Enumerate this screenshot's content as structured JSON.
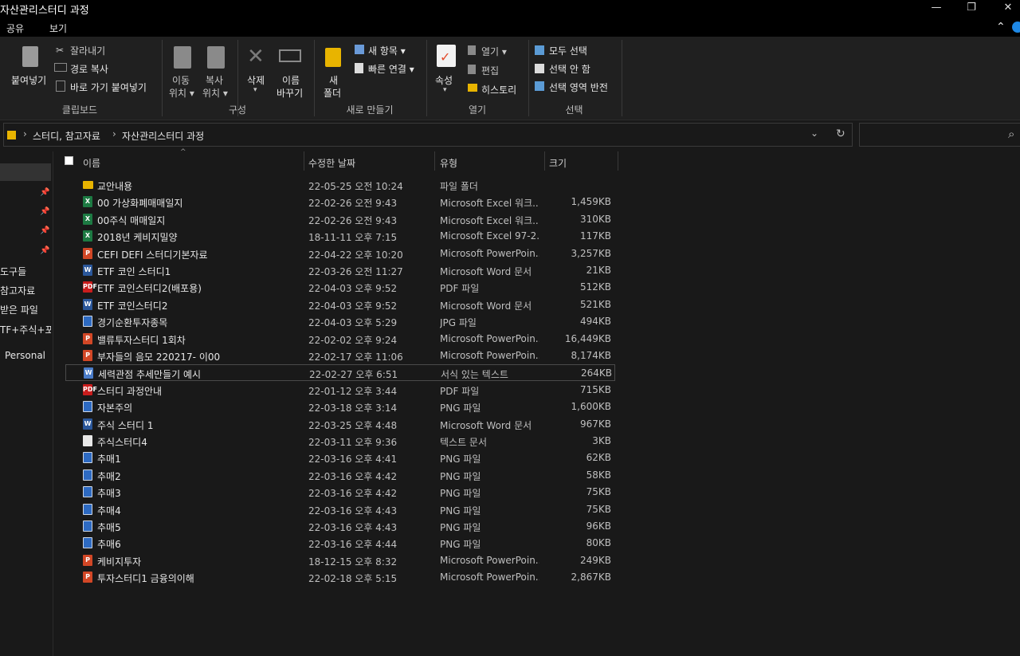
{
  "window": {
    "title": "자산관리스터디 과정",
    "controls": {
      "minimize": "—",
      "maximize": "❐",
      "close": "✕"
    }
  },
  "menu": {
    "share": "공유",
    "view": "보기",
    "collapse": "⌃"
  },
  "ribbon": {
    "clipboard": {
      "paste": "붙여넣기",
      "cut": "잘라내기",
      "copy_path": "경로 복사",
      "paste_shortcut": "바로 가기 붙여넣기",
      "label": "클립보드"
    },
    "organize": {
      "move_to_1": "이동",
      "move_to_2": "위치 ▾",
      "copy_to_1": "복사",
      "copy_to_2": "위치 ▾",
      "delete": "삭제",
      "delete_arrow": "▾",
      "rename_1": "이름",
      "rename_2": "바꾸기",
      "label": "구성"
    },
    "new": {
      "new_folder_1": "새",
      "new_folder_2": "폴더",
      "new_item": "새 항목 ▾",
      "easy_access": "빠른 연결 ▾",
      "label": "새로 만들기"
    },
    "open": {
      "properties": "속성",
      "properties_arrow": "▾",
      "open": "열기 ▾",
      "edit": "편집",
      "history": "히스토리",
      "label": "열기"
    },
    "select": {
      "select_all": "모두 선택",
      "select_none": "선택 안 함",
      "invert": "선택 영역 반전",
      "label": "선택"
    }
  },
  "address": {
    "crumbs": [
      "스터디, 참고자료",
      "자산관리스터디 과정"
    ],
    "sep": "›",
    "dropdown": "⌄",
    "refresh": "↻",
    "search_icon": "⌕"
  },
  "nav": {
    "items": [
      "도구들",
      "참고자료",
      "받은 파일",
      "TF+주식+포",
      "Personal"
    ]
  },
  "columns": {
    "name": "이름",
    "date": "수정한 날짜",
    "type": "유형",
    "size": "크기"
  },
  "files": [
    {
      "name": "교안내용",
      "date": "22-05-25 오전 10:24",
      "type": "파일 폴더",
      "size": "",
      "icon": "folder"
    },
    {
      "name": "00  가상화폐매매일지",
      "date": "22-02-26 오전 9:43",
      "type": "Microsoft Excel 워크...",
      "size": "1,459KB",
      "icon": "excel"
    },
    {
      "name": "00주식 매매일지",
      "date": "22-02-26 오전 9:43",
      "type": "Microsoft Excel 워크...",
      "size": "310KB",
      "icon": "excel"
    },
    {
      "name": "2018년  케비지밀양",
      "date": "18-11-11 오후 7:15",
      "type": "Microsoft Excel 97-2...",
      "size": "117KB",
      "icon": "excel"
    },
    {
      "name": "CEFI DEFI 스터디기본자료",
      "date": "22-04-22 오후 10:20",
      "type": "Microsoft PowerPoin...",
      "size": "3,257KB",
      "icon": "ppt"
    },
    {
      "name": "ETF 코인 스터디1",
      "date": "22-03-26 오전 11:27",
      "type": "Microsoft Word 문서",
      "size": "21KB",
      "icon": "word"
    },
    {
      "name": "ETF 코인스터디2(배포용)",
      "date": "22-04-03 오후 9:52",
      "type": "PDF 파일",
      "size": "512KB",
      "icon": "pdf"
    },
    {
      "name": "ETF 코인스터디2",
      "date": "22-04-03 오후 9:52",
      "type": "Microsoft Word 문서",
      "size": "521KB",
      "icon": "word"
    },
    {
      "name": "경기순환투자종목",
      "date": "22-04-03 오후 5:29",
      "type": "JPG 파일",
      "size": "494KB",
      "icon": "img"
    },
    {
      "name": "밸류투자스터디 1회차",
      "date": "22-02-02 오후 9:24",
      "type": "Microsoft PowerPoin...",
      "size": "16,449KB",
      "icon": "ppt"
    },
    {
      "name": "부자들의 음모 220217- 이00",
      "date": "22-02-17 오후 11:06",
      "type": "Microsoft PowerPoin...",
      "size": "8,174KB",
      "icon": "ppt"
    },
    {
      "name": "세력관점 추세만들기 예시",
      "date": "22-02-27 오후 6:51",
      "type": "서식 있는 텍스트",
      "size": "264KB",
      "icon": "rtf"
    },
    {
      "name": "스터디 과정안내",
      "date": "22-01-12 오후 3:44",
      "type": "PDF 파일",
      "size": "715KB",
      "icon": "pdf"
    },
    {
      "name": "자본주의",
      "date": "22-03-18 오후 3:14",
      "type": "PNG 파일",
      "size": "1,600KB",
      "icon": "img"
    },
    {
      "name": "주식 스터디 1",
      "date": "22-03-25 오후 4:48",
      "type": "Microsoft Word 문서",
      "size": "967KB",
      "icon": "word"
    },
    {
      "name": "주식스터디4",
      "date": "22-03-11 오후 9:36",
      "type": "텍스트 문서",
      "size": "3KB",
      "icon": "txt"
    },
    {
      "name": "추매1",
      "date": "22-03-16 오후 4:41",
      "type": "PNG 파일",
      "size": "62KB",
      "icon": "img"
    },
    {
      "name": "추매2",
      "date": "22-03-16 오후 4:42",
      "type": "PNG 파일",
      "size": "58KB",
      "icon": "img"
    },
    {
      "name": "추매3",
      "date": "22-03-16 오후 4:42",
      "type": "PNG 파일",
      "size": "75KB",
      "icon": "img"
    },
    {
      "name": "추매4",
      "date": "22-03-16 오후 4:43",
      "type": "PNG 파일",
      "size": "75KB",
      "icon": "img"
    },
    {
      "name": "추매5",
      "date": "22-03-16 오후 4:43",
      "type": "PNG 파일",
      "size": "96KB",
      "icon": "img"
    },
    {
      "name": "추매6",
      "date": "22-03-16 오후 4:44",
      "type": "PNG 파일",
      "size": "80KB",
      "icon": "img"
    },
    {
      "name": "케비지투자",
      "date": "18-12-15 오후 8:32",
      "type": "Microsoft PowerPoin...",
      "size": "249KB",
      "icon": "ppt"
    },
    {
      "name": "투자스터디1 금융의이해",
      "date": "22-02-18 오후 5:15",
      "type": "Microsoft PowerPoin...",
      "size": "2,867KB",
      "icon": "ppt"
    }
  ],
  "highlighted_row": 11,
  "icon_glyphs": {
    "folder": "",
    "excel": "X",
    "ppt": "P",
    "word": "W",
    "pdf": "PDF",
    "img": "",
    "rtf": "W",
    "txt": ""
  }
}
